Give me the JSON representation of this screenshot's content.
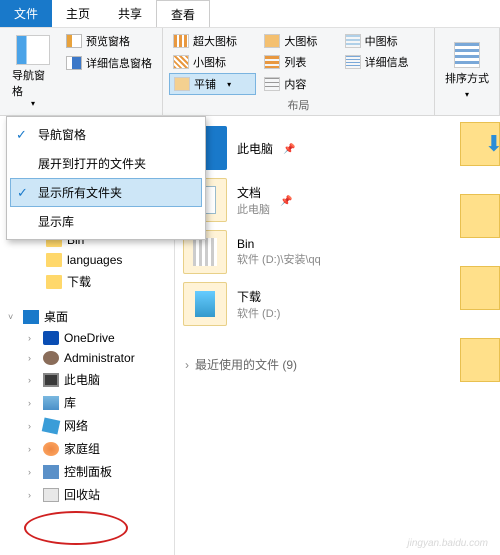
{
  "tabs": {
    "file": "文件",
    "home": "主页",
    "share": "共享",
    "view": "查看"
  },
  "ribbon": {
    "navPane": "导航窗格",
    "preview": "预览窗格",
    "details": "详细信息窗格",
    "xlIcons": "超大图标",
    "lgIcons": "大图标",
    "medIcons": "中图标",
    "smIcons": "小图标",
    "list": "列表",
    "detview": "详细信息",
    "tiles": "平铺",
    "content": "内容",
    "sort": "排序方式",
    "groupLayout": "布局"
  },
  "dropdown": {
    "navPane": "导航窗格",
    "expandOpen": "展开到打开的文件夹",
    "showAll": "显示所有文件夹",
    "showLib": "显示库"
  },
  "tree": {
    "bin": "Bin",
    "languages": "languages",
    "downloads": "下载",
    "desktop": "桌面",
    "oneDrive": "OneDrive",
    "admin": "Administrator",
    "thisPC": "此电脑",
    "libraries": "库",
    "network": "网络",
    "homegroup": "家庭组",
    "controlPanel": "控制面板",
    "recycle": "回收站"
  },
  "files": {
    "thisPC": {
      "name": "此电脑",
      "sub": ""
    },
    "docs": {
      "name": "文档",
      "sub": "此电脑"
    },
    "bin": {
      "name": "Bin",
      "sub": "软件 (D:)\\安装\\qq"
    },
    "dl": {
      "name": "下载",
      "sub": "软件 (D:)"
    }
  },
  "recent": {
    "label": "最近使用的文件 (9)"
  },
  "watermark": "jingyan.baidu.com"
}
